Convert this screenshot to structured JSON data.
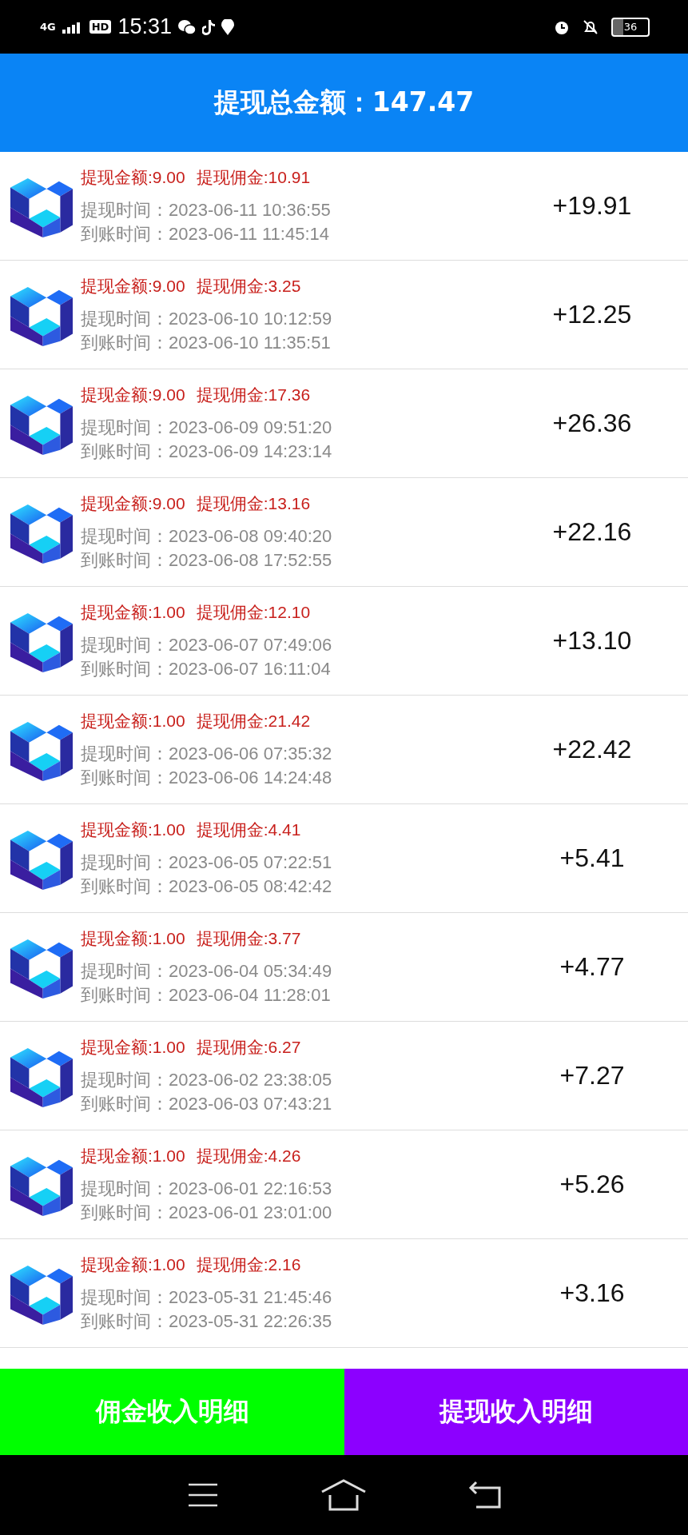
{
  "status_bar": {
    "network": "4G",
    "hd": "HD",
    "time": "15:31",
    "battery": "36"
  },
  "header": {
    "title": "提现总金额：147.47"
  },
  "records": [
    {
      "amount": "提现金额:9.00",
      "commission": "提现佣金:10.91",
      "withdraw_time": "提现时间：2023-06-11 10:36:55",
      "arrival_time": "到账时间：2023-06-11 11:45:14",
      "total": "+19.91"
    },
    {
      "amount": "提现金额:9.00",
      "commission": "提现佣金:3.25",
      "withdraw_time": "提现时间：2023-06-10 10:12:59",
      "arrival_time": "到账时间：2023-06-10 11:35:51",
      "total": "+12.25"
    },
    {
      "amount": "提现金额:9.00",
      "commission": "提现佣金:17.36",
      "withdraw_time": "提现时间：2023-06-09 09:51:20",
      "arrival_time": "到账时间：2023-06-09 14:23:14",
      "total": "+26.36"
    },
    {
      "amount": "提现金额:9.00",
      "commission": "提现佣金:13.16",
      "withdraw_time": "提现时间：2023-06-08 09:40:20",
      "arrival_time": "到账时间：2023-06-08 17:52:55",
      "total": "+22.16"
    },
    {
      "amount": "提现金额:1.00",
      "commission": "提现佣金:12.10",
      "withdraw_time": "提现时间：2023-06-07 07:49:06",
      "arrival_time": "到账时间：2023-06-07 16:11:04",
      "total": "+13.10"
    },
    {
      "amount": "提现金额:1.00",
      "commission": "提现佣金:21.42",
      "withdraw_time": "提现时间：2023-06-06 07:35:32",
      "arrival_time": "到账时间：2023-06-06 14:24:48",
      "total": "+22.42"
    },
    {
      "amount": "提现金额:1.00",
      "commission": "提现佣金:4.41",
      "withdraw_time": "提现时间：2023-06-05 07:22:51",
      "arrival_time": "到账时间：2023-06-05 08:42:42",
      "total": "+5.41"
    },
    {
      "amount": "提现金额:1.00",
      "commission": "提现佣金:3.77",
      "withdraw_time": "提现时间：2023-06-04 05:34:49",
      "arrival_time": "到账时间：2023-06-04 11:28:01",
      "total": "+4.77"
    },
    {
      "amount": "提现金额:1.00",
      "commission": "提现佣金:6.27",
      "withdraw_time": "提现时间：2023-06-02 23:38:05",
      "arrival_time": "到账时间：2023-06-03 07:43:21",
      "total": "+7.27"
    },
    {
      "amount": "提现金额:1.00",
      "commission": "提现佣金:4.26",
      "withdraw_time": "提现时间：2023-06-01 22:16:53",
      "arrival_time": "到账时间：2023-06-01 23:01:00",
      "total": "+5.26"
    },
    {
      "amount": "提现金额:1.00",
      "commission": "提现佣金:2.16",
      "withdraw_time": "提现时间：2023-05-31 21:45:46",
      "arrival_time": "到账时间：2023-05-31 22:26:35",
      "total": "+3.16"
    }
  ],
  "tabs": [
    {
      "label": "佣金收入明细",
      "color": "#00ff00"
    },
    {
      "label": "提现收入明细",
      "color": "#8c00ff"
    }
  ]
}
